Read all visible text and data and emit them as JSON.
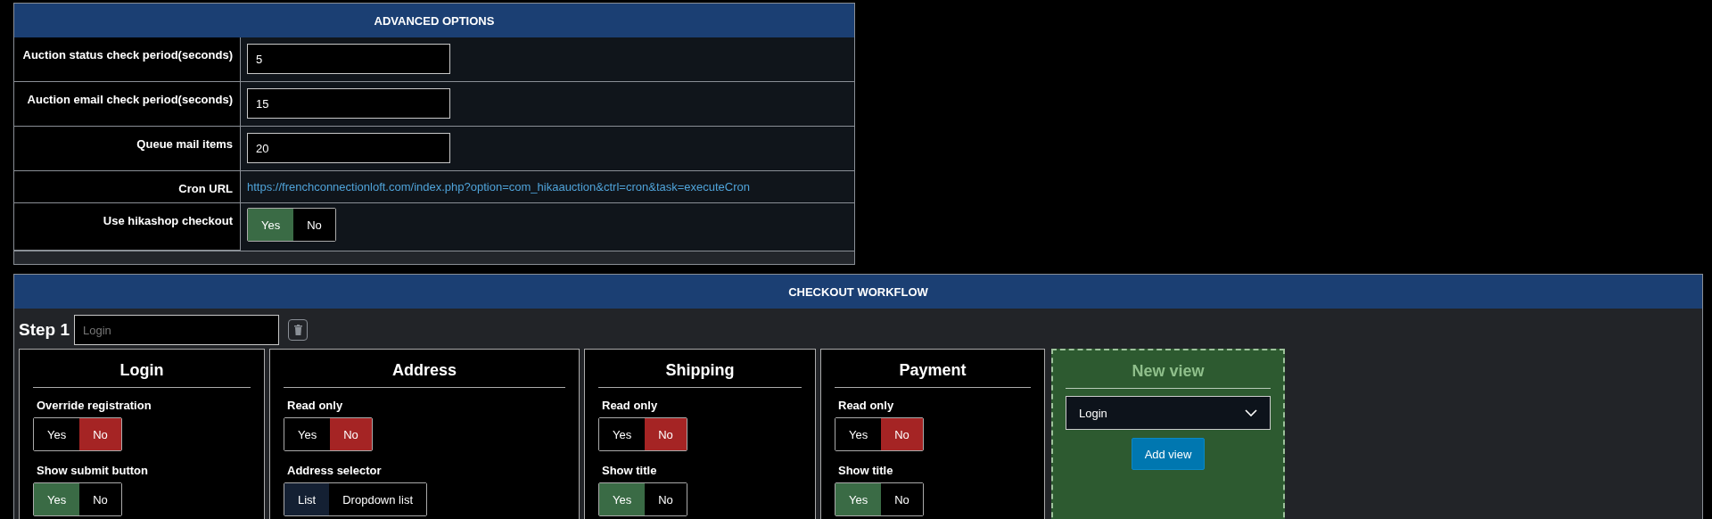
{
  "advanced_options": {
    "title": "ADVANCED OPTIONS",
    "rows": [
      {
        "kind": "input",
        "label": "Auction status check period(seconds)",
        "value": "5"
      },
      {
        "kind": "input",
        "label": "Auction email check period(seconds)",
        "value": "15"
      },
      {
        "kind": "input",
        "label": "Queue mail items",
        "value": "20"
      },
      {
        "kind": "link",
        "label": "Cron URL",
        "value": "https://frenchconnectionloft.com/index.php?option=com_hikaauction&ctrl=cron&task=executeCron"
      },
      {
        "kind": "toggle",
        "label": "Use hikashop checkout",
        "options": [
          {
            "label": "Yes",
            "selected": true
          },
          {
            "label": "No",
            "selected": false
          }
        ]
      }
    ]
  },
  "checkout_workflow": {
    "title": "CHECKOUT WORKFLOW",
    "step": {
      "label": "Step 1",
      "placeholder": "Login"
    },
    "views": [
      {
        "title": "Login",
        "settings": [
          {
            "label": "Override registration",
            "kind": "yesno",
            "options": [
              {
                "label": "Yes",
                "selected": false
              },
              {
                "label": "No",
                "selected": true
              }
            ]
          },
          {
            "label": "Show submit button",
            "kind": "yesno",
            "options": [
              {
                "label": "Yes",
                "selected": true
              },
              {
                "label": "No",
                "selected": false
              }
            ]
          }
        ]
      },
      {
        "title": "Address",
        "settings": [
          {
            "label": "Read only",
            "kind": "yesno",
            "options": [
              {
                "label": "Yes",
                "selected": false
              },
              {
                "label": "No",
                "selected": true
              }
            ]
          },
          {
            "label": "Address selector",
            "kind": "choice",
            "options": [
              {
                "label": "List",
                "selected": true
              },
              {
                "label": "Dropdown list",
                "selected": false
              }
            ]
          }
        ]
      },
      {
        "title": "Shipping",
        "settings": [
          {
            "label": "Read only",
            "kind": "yesno",
            "options": [
              {
                "label": "Yes",
                "selected": false
              },
              {
                "label": "No",
                "selected": true
              }
            ]
          },
          {
            "label": "Show title",
            "kind": "yesno",
            "options": [
              {
                "label": "Yes",
                "selected": true
              },
              {
                "label": "No",
                "selected": false
              }
            ]
          }
        ]
      },
      {
        "title": "Payment",
        "settings": [
          {
            "label": "Read only",
            "kind": "yesno",
            "options": [
              {
                "label": "Yes",
                "selected": false
              },
              {
                "label": "No",
                "selected": true
              }
            ]
          },
          {
            "label": "Show title",
            "kind": "yesno",
            "options": [
              {
                "label": "Yes",
                "selected": true
              },
              {
                "label": "No",
                "selected": false
              }
            ]
          }
        ]
      }
    ],
    "new_view": {
      "title": "New view",
      "select_value": "Login",
      "button": "Add view"
    }
  }
}
